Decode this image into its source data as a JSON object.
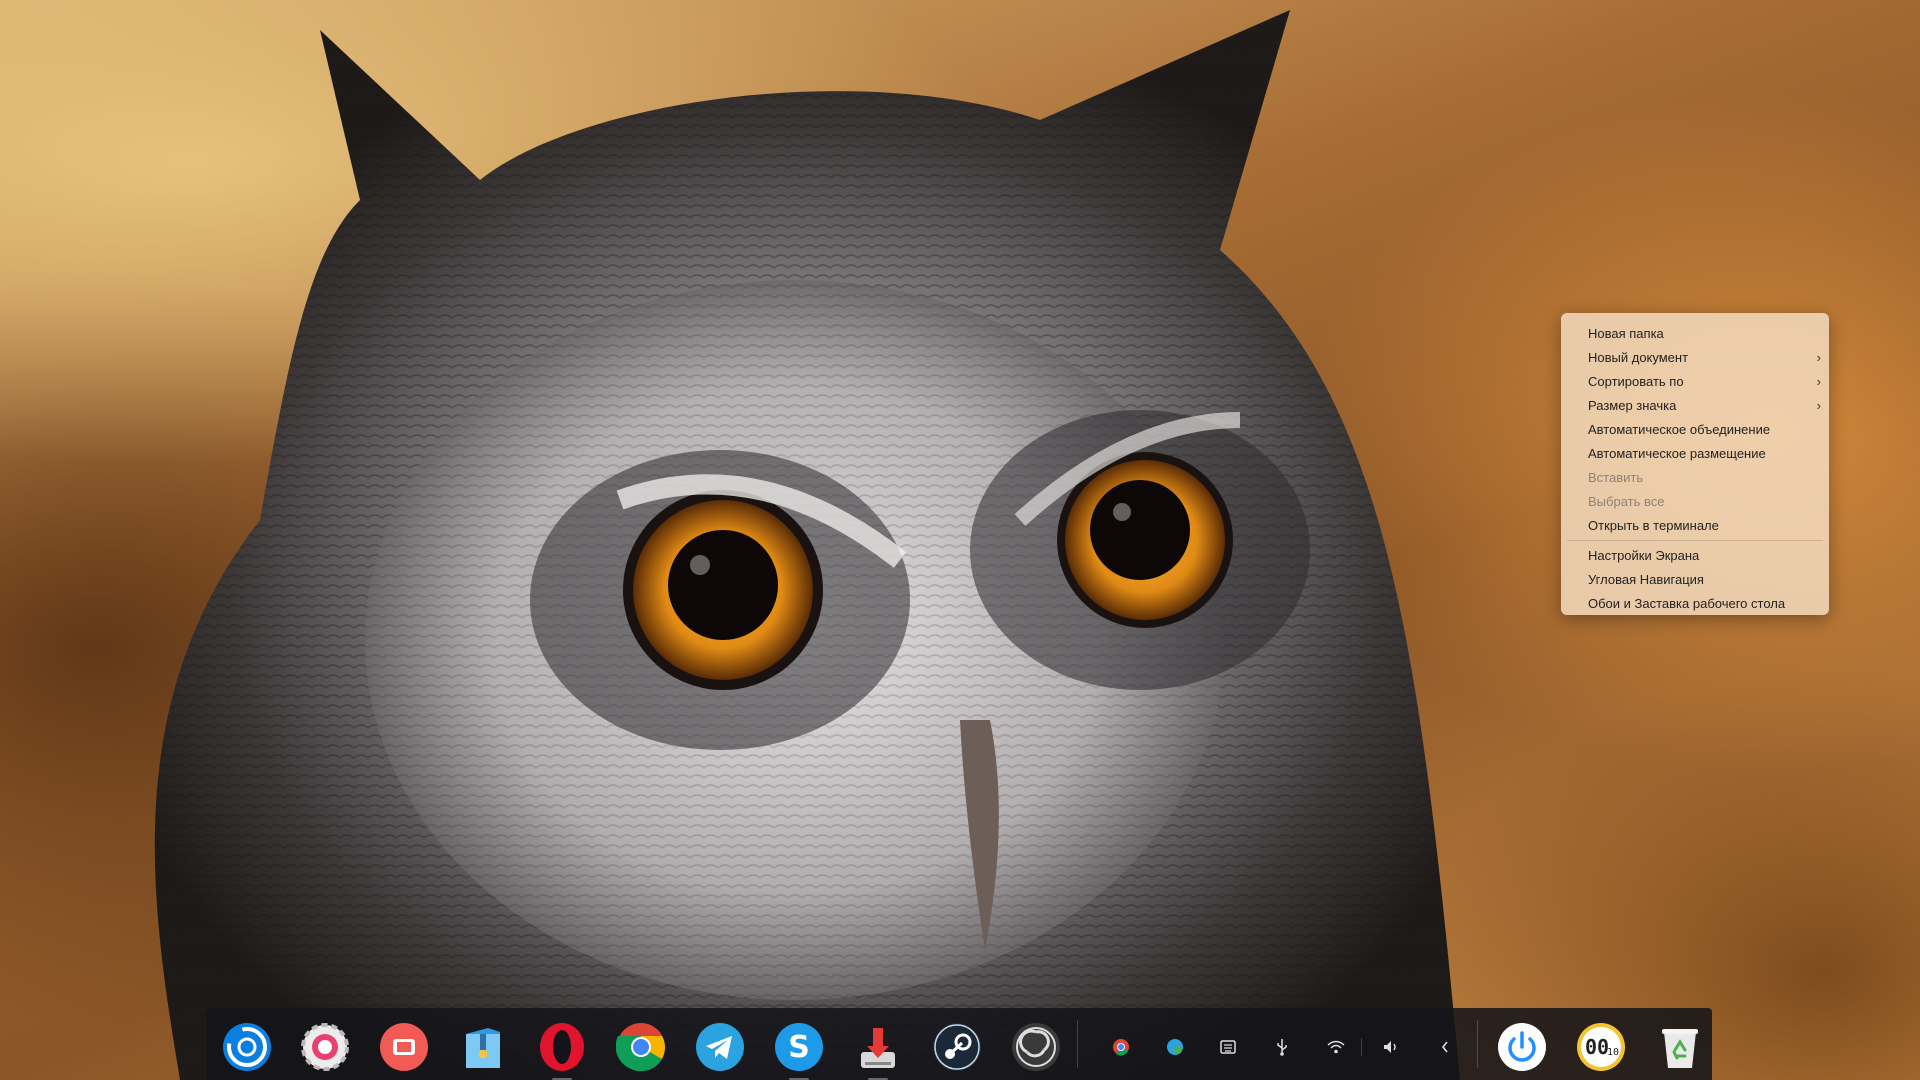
{
  "desktop": {
    "wallpaper": "owl-photo-wallpaper"
  },
  "context_menu": {
    "items": [
      {
        "label": "Новая папка",
        "submenu": false,
        "disabled": false
      },
      {
        "label": "Новый документ",
        "submenu": true,
        "disabled": false
      },
      {
        "label": "Сортировать по",
        "submenu": true,
        "disabled": false
      },
      {
        "label": "Размер значка",
        "submenu": true,
        "disabled": false
      },
      {
        "label": "Автоматическое объединение",
        "submenu": false,
        "disabled": false
      },
      {
        "label": "Автоматическое размещение",
        "submenu": false,
        "disabled": false
      },
      {
        "label": "Вставить",
        "submenu": false,
        "disabled": true
      },
      {
        "label": "Выбрать все",
        "submenu": false,
        "disabled": true
      },
      {
        "label": "Открыть в терминале",
        "submenu": false,
        "disabled": false
      }
    ],
    "items_after_separator": [
      {
        "label": "Настройки Экрана",
        "submenu": false,
        "disabled": false
      },
      {
        "label": "Угловая Навигация",
        "submenu": false,
        "disabled": false
      },
      {
        "label": "Обои и Заставка рабочего стола",
        "submenu": false,
        "disabled": false
      }
    ],
    "submenu_arrow": "›"
  },
  "dock": {
    "apps": [
      {
        "name": "launcher-icon",
        "running": false
      },
      {
        "name": "settings-icon",
        "running": false
      },
      {
        "name": "screen-recorder-icon",
        "running": false
      },
      {
        "name": "archive-manager-icon",
        "running": false
      },
      {
        "name": "opera-icon",
        "running": true
      },
      {
        "name": "chrome-icon",
        "running": false
      },
      {
        "name": "telegram-icon",
        "running": false
      },
      {
        "name": "skype-icon",
        "running": true
      },
      {
        "name": "downloader-icon",
        "running": true
      },
      {
        "name": "steam-icon",
        "running": false
      },
      {
        "name": "obs-icon",
        "running": false
      }
    ],
    "tray": [
      "chrome-tray-icon",
      "messenger-tray-icon",
      "keyboard-icon",
      "usb-icon",
      "wifi-icon",
      "volume-icon",
      "chevron-left-icon"
    ],
    "clock_hours": "00",
    "clock_minutes": "10",
    "colors": {
      "dock_bg": "#141418",
      "accent_blue": "#1e90ff",
      "opera_red": "#e0152d",
      "telegram_blue": "#2aa3e0",
      "recycle_green": "#4caf50"
    }
  }
}
